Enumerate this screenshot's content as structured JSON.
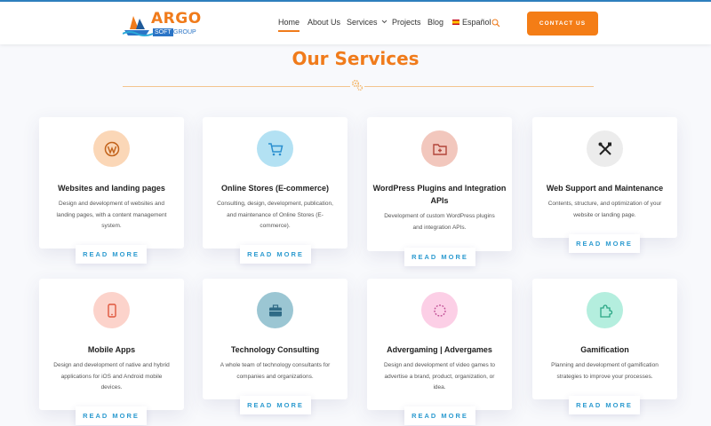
{
  "header": {
    "logo": {
      "main": "ARGO",
      "soft": "SOFT",
      "group": "GROUP"
    },
    "nav": [
      {
        "label": "Home"
      },
      {
        "label": "About Us"
      },
      {
        "label": "Services"
      },
      {
        "label": "Projects"
      },
      {
        "label": "Blog"
      },
      {
        "label": "Español"
      }
    ],
    "contact_label": "CONTACT US"
  },
  "section": {
    "title": "Our Services"
  },
  "colors": {
    "accent": "#f07b1b",
    "link": "#2d9bd0",
    "nav_top_bar": "#2e80c0"
  },
  "read_more_label": "READ MORE",
  "services": [
    {
      "title": "Websites and landing pages",
      "desc": [
        "Design and development of websites and",
        "landing pages, with a content management",
        "system."
      ],
      "icon": "wordpress-icon",
      "icon_bg": "#fbd7b7"
    },
    {
      "title": "Online Stores (E-commerce)",
      "desc": [
        "Consulting, design, development, publication,",
        "and maintenance of Online Stores (E-",
        "commerce)."
      ],
      "icon": "shopping-cart-icon",
      "icon_bg": "#b3e1f3"
    },
    {
      "title": [
        "WordPress Plugins and Integration",
        "APIs"
      ],
      "desc": [
        "Development of custom WordPress plugins",
        "and integration APIs."
      ],
      "icon": "plugin-folder-icon",
      "icon_bg": "#f2c7bd"
    },
    {
      "title": "Web Support and Maintenance",
      "desc": [
        "Contents, structure, and optimization of your",
        "website or landing page."
      ],
      "icon": "tools-icon",
      "icon_bg": "#ececec"
    },
    {
      "title": "Mobile Apps",
      "desc": [
        "Design and development of native and hybrid",
        "applications for iOS and Android mobile",
        "devices."
      ],
      "icon": "mobile-phone-icon",
      "icon_bg": "#fcd3cb"
    },
    {
      "title": "Technology Consulting",
      "desc": [
        "A whole team of technology consultants for",
        "companies and organizations."
      ],
      "icon": "briefcase-icon",
      "icon_bg": "#9bc6d3"
    },
    {
      "title": "Advergaming | Advergames",
      "desc": [
        "Design and development of video games to",
        "advertise a brand, product, organization, or",
        "idea."
      ],
      "icon": "loading-spinner-icon",
      "icon_bg": "#fccfe6"
    },
    {
      "title": "Gamification",
      "desc": [
        "Planning and development of gamification",
        "strategies to improve your processes."
      ],
      "icon": "puzzle-piece-icon",
      "icon_bg": "#b4eede"
    }
  ]
}
